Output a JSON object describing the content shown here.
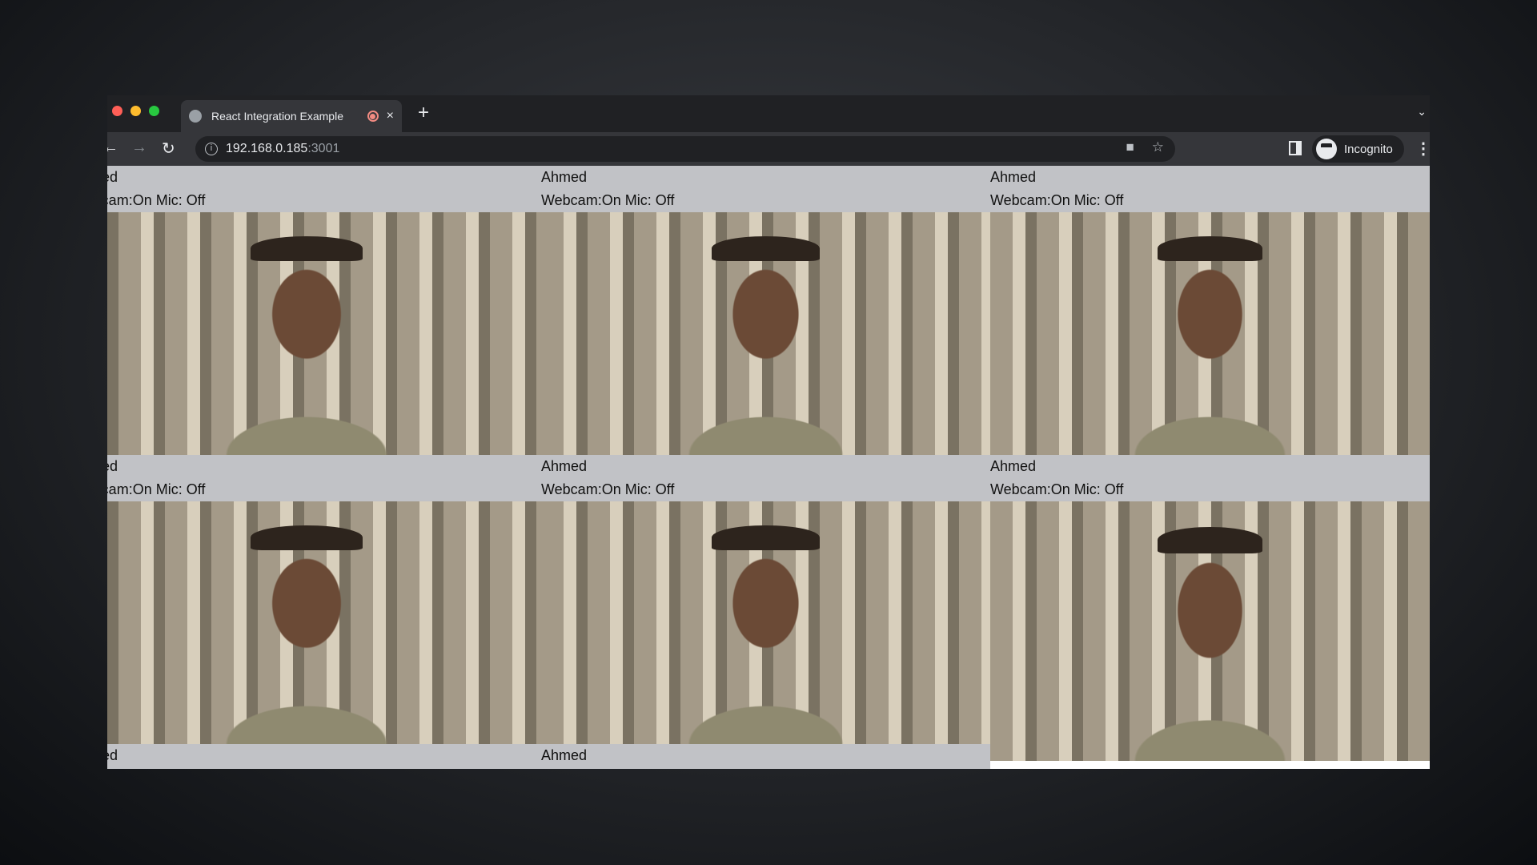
{
  "browser": {
    "tab_title": "React Integration Example",
    "new_tab": "+",
    "close": "×",
    "address_host": "192.168.0.185",
    "address_port": ":3001",
    "profile": "Incognito",
    "colors": {
      "close": "#ff5f57",
      "minimize": "#febc2e",
      "zoom": "#28c840",
      "recording": "#f28b82"
    }
  },
  "tiles": [
    {
      "name": "Ahmed",
      "status": "Webcam:On Mic: Off"
    },
    {
      "name": "Ahmed",
      "status": "Webcam:On Mic: Off"
    },
    {
      "name": "Ahmed",
      "status": "Webcam:On Mic: Off"
    },
    {
      "name": "Ahmed",
      "status": "Webcam:On Mic: Off"
    },
    {
      "name": "Ahmed",
      "status": "Webcam:On Mic: Off"
    },
    {
      "name": "Ahmed",
      "status": "Webcam:On Mic: Off"
    },
    {
      "name": "Ahmed"
    },
    {
      "name": "Ahmed"
    }
  ]
}
